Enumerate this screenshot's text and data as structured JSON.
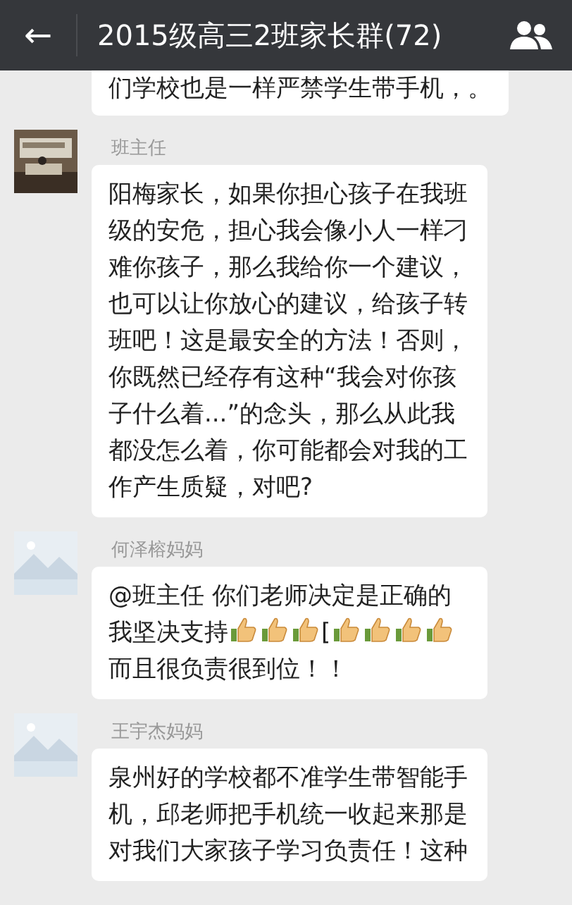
{
  "header": {
    "back": "←",
    "title": "2015级高三2班家长群(72)"
  },
  "messages": [
    {
      "segments": [
        {
          "kind": "text",
          "text": "们学校也是一样严禁学生带手机，。"
        }
      ]
    },
    {
      "sender": "班主任",
      "segments": [
        {
          "kind": "text",
          "text": "阳梅家长，如果你担心孩子在我班级的安危，担心我会像小人一样刁难你孩子，那么我给你一个建议，也可以让你放心的建议，给孩子转班吧！这是最安全的方法！否则，你既然已经存有这种“我会对你孩子什么着...”的念头，那么从此我都没怎么着，你可能都会对我的工作产生质疑，对吧?"
        }
      ]
    },
    {
      "sender": "何泽榕妈妈",
      "avatar": {
        "kind": "placeholder"
      },
      "segments": [
        {
          "kind": "text",
          "text": "@班主任 你们老师决定是正确的我坚决支持"
        },
        {
          "kind": "thumb"
        },
        {
          "kind": "thumb"
        },
        {
          "kind": "thumb"
        },
        {
          "kind": "text",
          "text": "["
        },
        {
          "kind": "thumb"
        },
        {
          "kind": "thumb"
        },
        {
          "kind": "thumb"
        },
        {
          "kind": "thumb"
        },
        {
          "kind": "text",
          "text": "而且很负责很到位！！"
        }
      ]
    },
    {
      "sender": "王宇杰妈妈",
      "avatar": {
        "kind": "placeholder"
      },
      "segments": [
        {
          "kind": "text",
          "text": "泉州好的学校都不准学生带智能手机，邱老师把手机统一收起来那是对我们大家孩子学习负责任！这种"
        }
      ]
    }
  ]
}
